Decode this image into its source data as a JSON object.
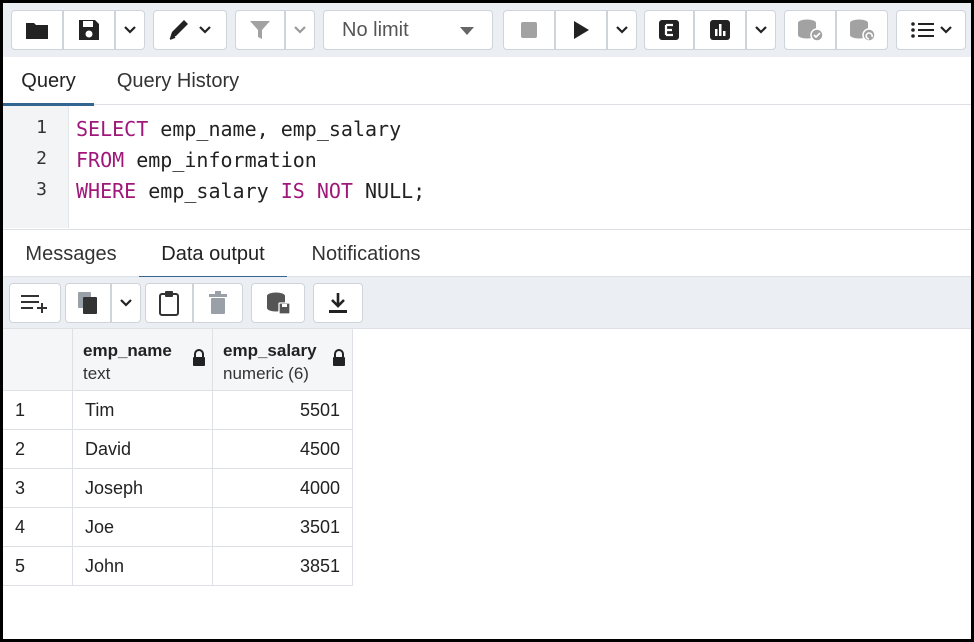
{
  "toolbar": {
    "limit_label": "No limit",
    "buttons": [
      "open-file",
      "save",
      "edit",
      "filter",
      "stop",
      "execute",
      "explain",
      "explain-analyze",
      "commit",
      "rollback",
      "macros"
    ]
  },
  "query_tabs": [
    {
      "label": "Query",
      "active": true
    },
    {
      "label": "Query History",
      "active": false
    }
  ],
  "editor": {
    "line_numbers": [
      "1",
      "2",
      "3"
    ],
    "lines": [
      [
        {
          "t": "SELECT",
          "kw": true
        },
        {
          "t": " emp_name, emp_salary",
          "kw": false
        }
      ],
      [
        {
          "t": "FROM",
          "kw": true
        },
        {
          "t": " emp_information",
          "kw": false
        }
      ],
      [
        {
          "t": "WHERE",
          "kw": true
        },
        {
          "t": " emp_salary ",
          "kw": false
        },
        {
          "t": "IS NOT",
          "kw": true
        },
        {
          "t": " NULL;",
          "kw": false
        }
      ]
    ]
  },
  "result_tabs": [
    {
      "label": "Messages",
      "active": false
    },
    {
      "label": "Data output",
      "active": true
    },
    {
      "label": "Notifications",
      "active": false
    }
  ],
  "grid": {
    "columns": [
      {
        "name": "emp_name",
        "type": "text"
      },
      {
        "name": "emp_salary",
        "type": "numeric (6)"
      }
    ],
    "rows": [
      {
        "index": "1",
        "emp_name": "Tim",
        "emp_salary": "5501"
      },
      {
        "index": "2",
        "emp_name": "David",
        "emp_salary": "4500"
      },
      {
        "index": "3",
        "emp_name": "Joseph",
        "emp_salary": "4000"
      },
      {
        "index": "4",
        "emp_name": "Joe",
        "emp_salary": "3501"
      },
      {
        "index": "5",
        "emp_name": "John",
        "emp_salary": "3851"
      }
    ]
  },
  "colors": {
    "keyword": "#a0177a",
    "tab_underline": "#326690",
    "toolbar_bg": "#ebeef3"
  }
}
